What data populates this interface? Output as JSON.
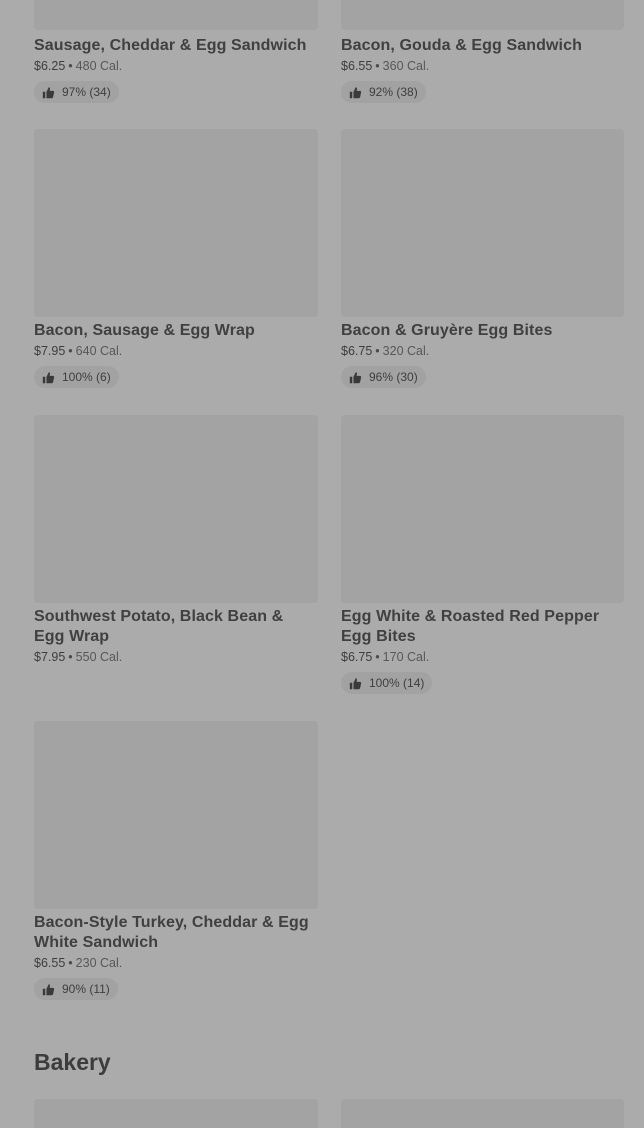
{
  "items": [
    {
      "name": "Sausage, Cheddar & Egg Sandwich",
      "price": "$6.25",
      "calories": "480 Cal.",
      "rating": "97% (34)"
    },
    {
      "name": "Bacon, Gouda & Egg Sandwich",
      "price": "$6.55",
      "calories": "360 Cal.",
      "rating": "92% (38)"
    },
    {
      "name": "Bacon, Sausage & Egg Wrap",
      "price": "$7.95",
      "calories": "640 Cal.",
      "rating": "100% (6)"
    },
    {
      "name": "Bacon & Gruyère Egg Bites",
      "price": "$6.75",
      "calories": "320 Cal.",
      "rating": "96% (30)"
    },
    {
      "name": "Southwest Potato, Black Bean & Egg Wrap",
      "price": "$7.95",
      "calories": "550 Cal."
    },
    {
      "name": "Egg White & Roasted Red Pepper Egg Bites",
      "price": "$6.75",
      "calories": "170 Cal.",
      "rating": "100% (14)"
    },
    {
      "name": "Bacon-Style Turkey, Cheddar & Egg White Sandwich",
      "price": "$6.55",
      "calories": "230 Cal.",
      "rating": "90% (11)"
    }
  ],
  "separator": "•",
  "section": {
    "title": "Bakery"
  },
  "colors": {
    "overlay": "#ababab",
    "image_placeholder": "#a3a3a3",
    "text": "#404040"
  },
  "icons": {
    "rating": "thumbs-up-icon"
  }
}
